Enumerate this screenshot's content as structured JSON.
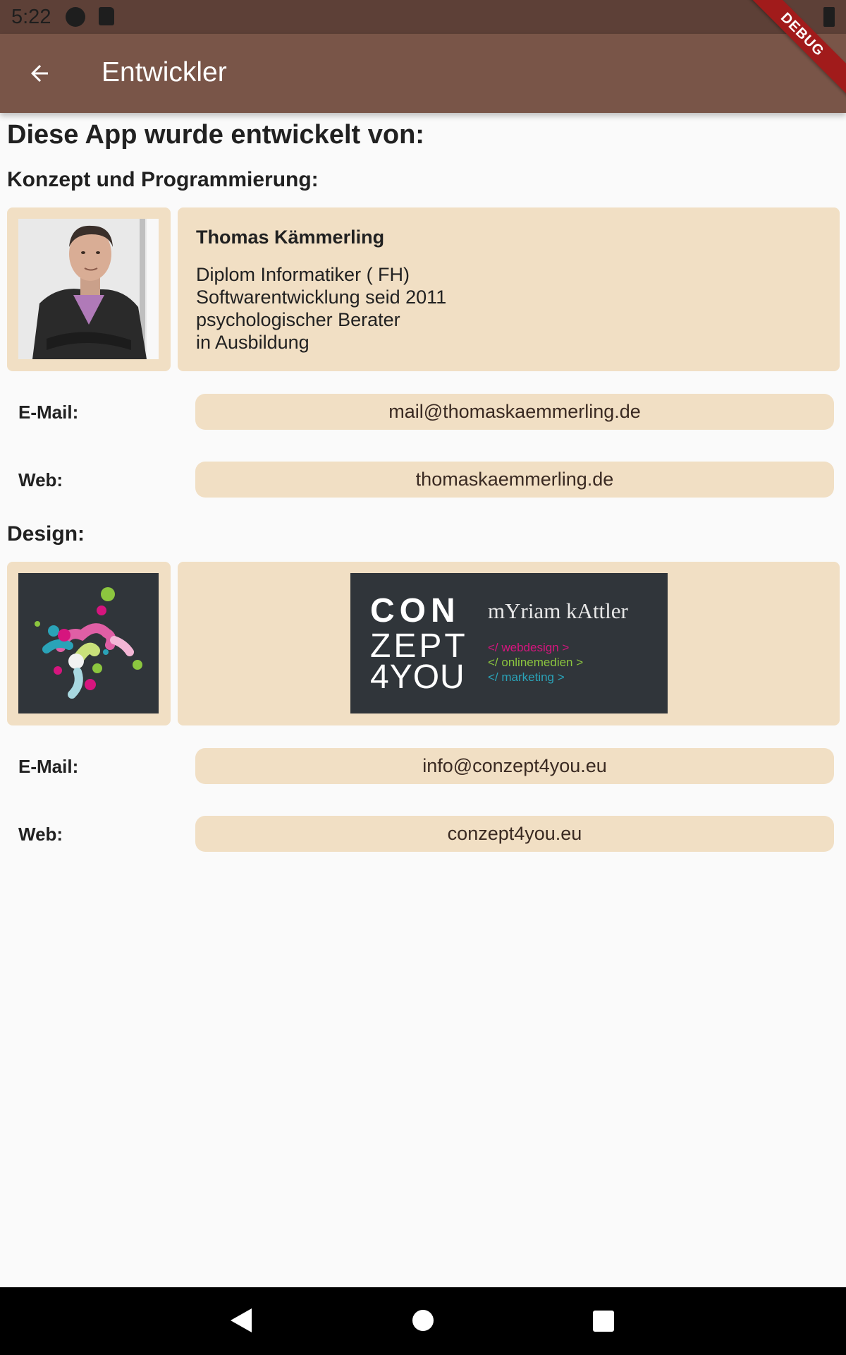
{
  "status_bar": {
    "time": "5:22"
  },
  "app_bar": {
    "title": "Entwickler",
    "debug_label": "DEBUG"
  },
  "page": {
    "heading": "Diese App wurde entwickelt von:",
    "section_concept": "Konzept und Programmierung:",
    "section_design": "Design:"
  },
  "developer": {
    "name": "Thomas Kämmerling",
    "lines": [
      "Diplom Informatiker ( FH)",
      "Softwarentwicklung seid 2011",
      "psychologischer Berater",
      "in Ausbildung"
    ],
    "email_label": "E-Mail:",
    "email": "mail@thomaskaemmerling.de",
    "web_label": "Web:",
    "web": "thomaskaemmerling.de"
  },
  "designer": {
    "banner": {
      "logo_lines": [
        "CON",
        "ZEPT",
        "4YOU"
      ],
      "name": "mYriam kAttler",
      "services": [
        "</ webdesign >",
        "</ onlinemedien >",
        "</ marketing >"
      ],
      "service_colors": [
        "#d6157e",
        "#8cc63f",
        "#2aa3b8"
      ]
    },
    "email_label": "E-Mail:",
    "email": "info@conzept4you.eu",
    "web_label": "Web:",
    "web": "conzept4you.eu"
  },
  "colors": {
    "app_bar": "#795548",
    "status_bar": "#5d4037",
    "card": "#f1dfc4"
  }
}
